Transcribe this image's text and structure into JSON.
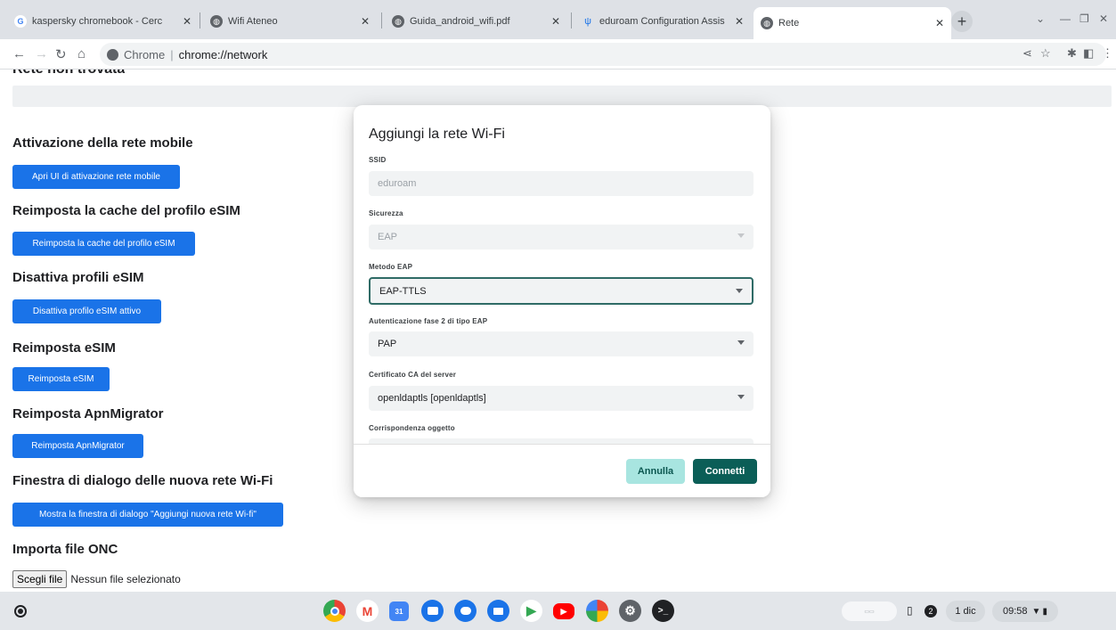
{
  "browser": {
    "tabs": [
      {
        "title": "kaspersky chromebook - Cerc",
        "icon": "google-g-icon"
      },
      {
        "title": "Wifi Ateneo",
        "icon": "globe-icon"
      },
      {
        "title": "Guida_android_wifi.pdf",
        "icon": "globe-icon"
      },
      {
        "title": "eduroam Configuration Assis",
        "icon": "eduroam-icon"
      },
      {
        "title": "Rete",
        "icon": "globe-icon"
      }
    ],
    "omnibox": {
      "chip": "Chrome",
      "url": "chrome://network"
    }
  },
  "page": {
    "cutoff_heading": "Rete non trovata",
    "sections": [
      {
        "title": "Attivazione della rete mobile",
        "button": "Apri UI di attivazione rete mobile"
      },
      {
        "title": "Reimposta la cache del profilo eSIM",
        "button": "Reimposta la cache del profilo eSIM"
      },
      {
        "title": "Disattiva profili eSIM",
        "button": "Disattiva profilo eSIM attivo"
      },
      {
        "title": "Reimposta eSIM",
        "button": "Reimposta eSIM"
      },
      {
        "title": "Reimposta ApnMigrator",
        "button": "Reimposta ApnMigrator"
      },
      {
        "title": "Finestra di dialogo delle nuova rete Wi-Fi",
        "button": "Mostra la finestra di dialogo \"Aggiungi nuova rete Wi-fi\""
      },
      {
        "title": "Importa file ONC"
      }
    ],
    "file_input": {
      "button": "Scegli file",
      "status": "Nessun file selezionato"
    }
  },
  "dialog": {
    "title": "Aggiungi la rete Wi-Fi",
    "fields": [
      {
        "label": "SSID",
        "value": "eduroam"
      },
      {
        "label": "Sicurezza",
        "value": "EAP"
      },
      {
        "label": "Metodo EAP",
        "value": "EAP-TTLS"
      },
      {
        "label": "Autenticazione fase 2 di tipo EAP",
        "value": "PAP"
      },
      {
        "label": "Certificato CA del server",
        "value": "openldaptls [openldaptls]"
      },
      {
        "label": "Corrispondenza oggetto",
        "value": ""
      }
    ],
    "cancel_label": "Annulla",
    "connect_label": "Connetti"
  },
  "shelf": {
    "apps": [
      {
        "name": "chrome-icon",
        "color": "#e8453c"
      },
      {
        "name": "gmail-icon",
        "color": "#ffffff"
      },
      {
        "name": "calendar-icon",
        "color": "#4285f4"
      },
      {
        "name": "files-icon",
        "color": "#1a73e8"
      },
      {
        "name": "messages-icon",
        "color": "#1a73e8"
      },
      {
        "name": "meet-icon",
        "color": "#1a73e8"
      },
      {
        "name": "play-store-icon",
        "color": "#ffffff"
      },
      {
        "name": "youtube-icon",
        "color": "#ff0000"
      },
      {
        "name": "photos-icon",
        "color": "#ffffff"
      },
      {
        "name": "settings-icon",
        "color": "#5f6368"
      },
      {
        "name": "terminal-icon",
        "color": "#202124"
      }
    ],
    "tray": {
      "notification_count": "2",
      "date": "1 dic",
      "time": "09:58"
    }
  },
  "colors": {
    "accent": "#1a73e8",
    "dialog_primary": "#0b5e57",
    "dialog_secondary": "#a8e5e0"
  }
}
